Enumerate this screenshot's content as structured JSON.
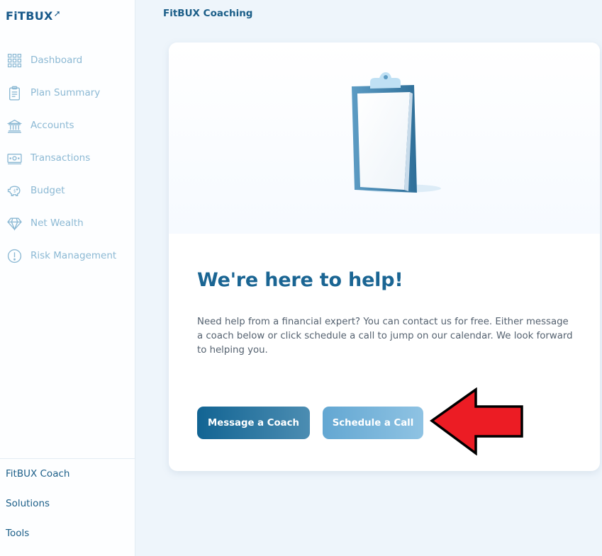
{
  "brand": {
    "logo_text": "FiTBUX",
    "logo_mark": "➚"
  },
  "sidebar": {
    "items": [
      {
        "label": "Dashboard",
        "icon": "grid-icon"
      },
      {
        "label": "Plan Summary",
        "icon": "clipboard-list-icon"
      },
      {
        "label": "Accounts",
        "icon": "bank-icon"
      },
      {
        "label": "Transactions",
        "icon": "cash-icon"
      },
      {
        "label": "Budget",
        "icon": "piggy-bank-icon"
      },
      {
        "label": "Net Wealth",
        "icon": "diamond-icon"
      },
      {
        "label": "Risk Management",
        "icon": "alert-circle-icon"
      }
    ],
    "bottom_items": [
      {
        "label": "FitBUX Coach"
      },
      {
        "label": "Solutions"
      },
      {
        "label": "Tools"
      }
    ]
  },
  "main": {
    "title": "FitBUX Coaching",
    "card": {
      "illustration": "clipboard-illustration",
      "heading": "We're here to help!",
      "description": "Need help from a financial expert? You can contact us for free. Either message a coach below or click schedule a call to jump on our calendar. We look forward to helping you.",
      "primary_button": "Message a Coach",
      "secondary_button": "Schedule a Call"
    },
    "annotation": {
      "shape": "red-arrow-icon",
      "color": "#e8192c"
    }
  },
  "colors": {
    "accent": "#1a6593",
    "nav_text": "#8cb9d4",
    "secondary_button": "#78b5dc"
  }
}
